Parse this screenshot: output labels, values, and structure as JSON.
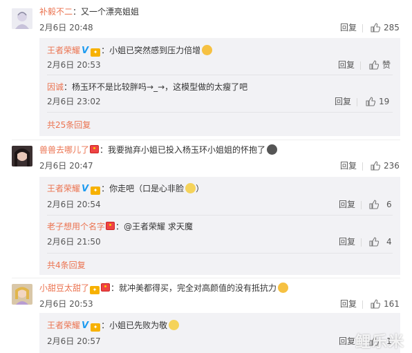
{
  "ui": {
    "reply_label": "回复",
    "like_word": "赞"
  },
  "comments": [
    {
      "user": "补毅不二",
      "text": "：又一个漂亮姐姐",
      "time": "2月6日 20:48",
      "likes": "285",
      "replies": [
        {
          "user": "王者荣耀",
          "text": "：小姐已突然感到压力倍增",
          "time": "2月6日 20:53",
          "likes": "赞"
        },
        {
          "user": "因诚",
          "text": "：杨玉环不是比较胖吗→_→，这模型做的太瘦了吧",
          "time": "2月6日 23:02",
          "likes": "19"
        }
      ],
      "more": "共25条回复"
    },
    {
      "user": "兽兽去哪儿了",
      "text": "：我要抛弃小姐已投入杨玉环小姐姐的怀抱了",
      "time": "2月6日 20:47",
      "likes": "236",
      "replies": [
        {
          "user": "王者荣耀",
          "text": "：你走吧（口是心非脸",
          "text_end": "）",
          "time": "2月6日 20:54",
          "likes": "6"
        },
        {
          "user": "老子想用个名字",
          "text": "：@王者荣耀 求天魔",
          "time": "2月6日 21:50",
          "likes": "4"
        }
      ],
      "more": "共4条回复"
    },
    {
      "user": "小甜豆太甜了",
      "text": "：就冲美都得买，完全对高颜值的没有抵抗力",
      "time": "2月6日 20:53",
      "likes": "161",
      "replies": [
        {
          "user": "王者荣耀",
          "text": "：小姐已先败为敬",
          "time": "2月6日 20:57",
          "likes": "1"
        }
      ]
    }
  ],
  "watermark": "鲤乐米"
}
